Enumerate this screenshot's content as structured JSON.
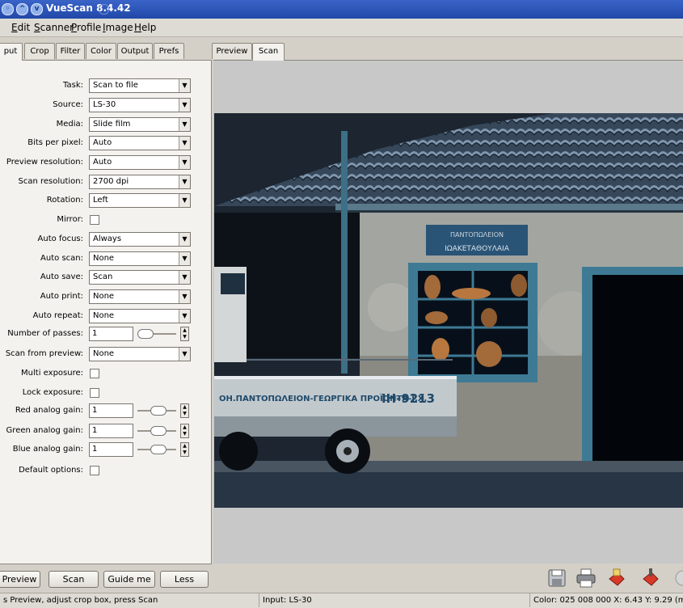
{
  "window": {
    "title": "VueScan 8.4.42"
  },
  "menu": [
    {
      "underline": "E",
      "rest": "dit"
    },
    {
      "underline": "S",
      "rest": "canner"
    },
    {
      "underline": "P",
      "rest": "rofile"
    },
    {
      "underline": "I",
      "rest": "mage"
    },
    {
      "underline": "H",
      "rest": "elp"
    }
  ],
  "left_tabs": [
    "put",
    "Crop",
    "Filter",
    "Color",
    "Output",
    "Prefs"
  ],
  "right_tabs": [
    "Preview",
    "Scan"
  ],
  "input_panel": {
    "task": {
      "label": "Task:",
      "value": "Scan to file"
    },
    "source": {
      "label": "Source:",
      "value": "LS-30"
    },
    "media": {
      "label": "Media:",
      "value": "Slide film"
    },
    "bits_per_pixel": {
      "label": "Bits per pixel:",
      "value": "Auto"
    },
    "preview_resolution": {
      "label": "Preview resolution:",
      "value": "Auto"
    },
    "scan_resolution": {
      "label": "Scan resolution:",
      "value": "2700 dpi"
    },
    "rotation": {
      "label": "Rotation:",
      "value": "Left"
    },
    "mirror": {
      "label": "Mirror:",
      "checked": false
    },
    "auto_focus": {
      "label": "Auto focus:",
      "value": "Always"
    },
    "auto_scan": {
      "label": "Auto scan:",
      "value": "None"
    },
    "auto_save": {
      "label": "Auto save:",
      "value": "Scan"
    },
    "auto_print": {
      "label": "Auto print:",
      "value": "None"
    },
    "auto_repeat": {
      "label": "Auto repeat:",
      "value": "None"
    },
    "number_of_passes": {
      "label": "Number of passes:",
      "value": "1",
      "slider_fraction": 0.0
    },
    "scan_from_preview": {
      "label": "Scan from preview:",
      "value": "None"
    },
    "multi_exposure": {
      "label": "Multi exposure:",
      "checked": false
    },
    "lock_exposure": {
      "label": "Lock exposure:",
      "checked": false
    },
    "red_analog_gain": {
      "label": "Red analog gain:",
      "value": "1",
      "slider_fraction": 0.5
    },
    "green_analog_gain": {
      "label": "Green analog gain:",
      "value": "1",
      "slider_fraction": 0.5
    },
    "blue_analog_gain": {
      "label": "Blue analog gain:",
      "value": "1",
      "slider_fraction": 0.5
    },
    "default_options": {
      "label": "Default options:",
      "checked": false
    }
  },
  "photo_text": {
    "sign": "ΙΩΑΚΕΤΑΘΟΥΛΑΙΑ",
    "truck_text": "ΟΗ.ΠΑΝΤΟΠΩΛΕΙΟΝ-ΓΕΩΡΓΙΚΑ ΠΡΟΪΟΝΤΑ-Ι.Χ.",
    "plate": "ΙΗ-9213"
  },
  "buttons": {
    "preview": "Preview",
    "scan": "Scan",
    "guide_me": "Guide me",
    "less": "Less"
  },
  "toolbar_icons": [
    "save-icon",
    "print-icon",
    "scan-to-email-icon",
    "scan-to-fax-icon"
  ],
  "status": {
    "hint": "s Preview, adjust crop box, press Scan",
    "input": "Input: LS-30",
    "color": "Color: 025 008 000  X:  6.43  Y:  9.29 (m"
  }
}
